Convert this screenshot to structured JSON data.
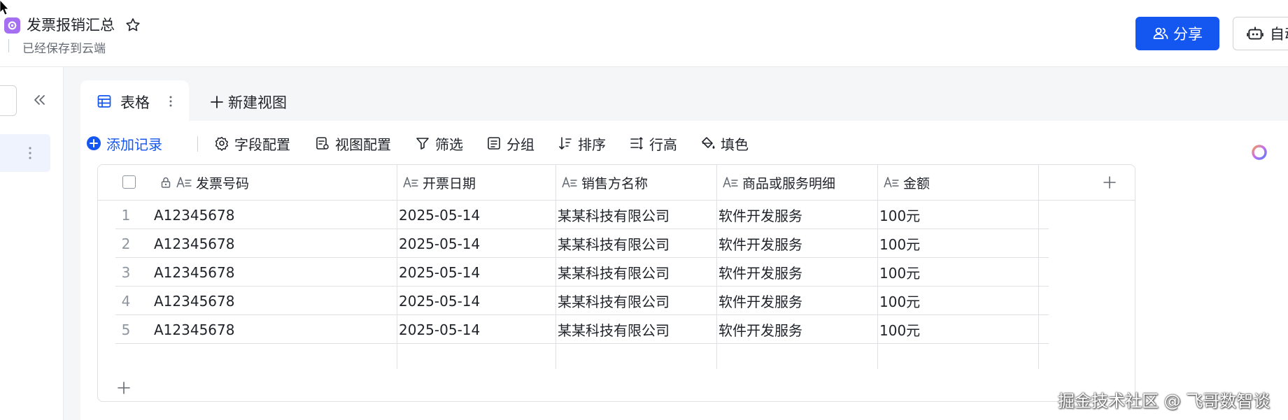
{
  "header": {
    "doc_title": "发票报销汇总",
    "save_status": "已经保存到云端",
    "share_label": "分享",
    "auto_label": "自动"
  },
  "view_tabs": {
    "active_label": "表格",
    "new_view_label": "新建视图"
  },
  "toolbar": {
    "add_record": "添加记录",
    "field_config": "字段配置",
    "view_config": "视图配置",
    "filter": "筛选",
    "group": "分组",
    "sort": "排序",
    "row_height": "行高",
    "fill_color": "填色"
  },
  "table": {
    "columns": [
      "发票号码",
      "开票日期",
      "销售方名称",
      "商品或服务明细",
      "金额"
    ],
    "rows": [
      {
        "num": "1",
        "cells": [
          "A12345678",
          "2025-05-14",
          "某某科技有限公司",
          "软件开发服务",
          "100元"
        ]
      },
      {
        "num": "2",
        "cells": [
          "A12345678",
          "2025-05-14",
          "某某科技有限公司",
          "软件开发服务",
          "100元"
        ]
      },
      {
        "num": "3",
        "cells": [
          "A12345678",
          "2025-05-14",
          "某某科技有限公司",
          "软件开发服务",
          "100元"
        ]
      },
      {
        "num": "4",
        "cells": [
          "A12345678",
          "2025-05-14",
          "某某科技有限公司",
          "软件开发服务",
          "100元"
        ]
      },
      {
        "num": "5",
        "cells": [
          "A12345678",
          "2025-05-14",
          "某某科技有限公司",
          "软件开发服务",
          "100元"
        ]
      }
    ]
  },
  "watermark": "掘金技术社区 @ 飞哥数智谈",
  "colors": {
    "primary": "#1456f0",
    "app_icon": "#a56ff2",
    "sidebar_active": "#eef3fd"
  }
}
